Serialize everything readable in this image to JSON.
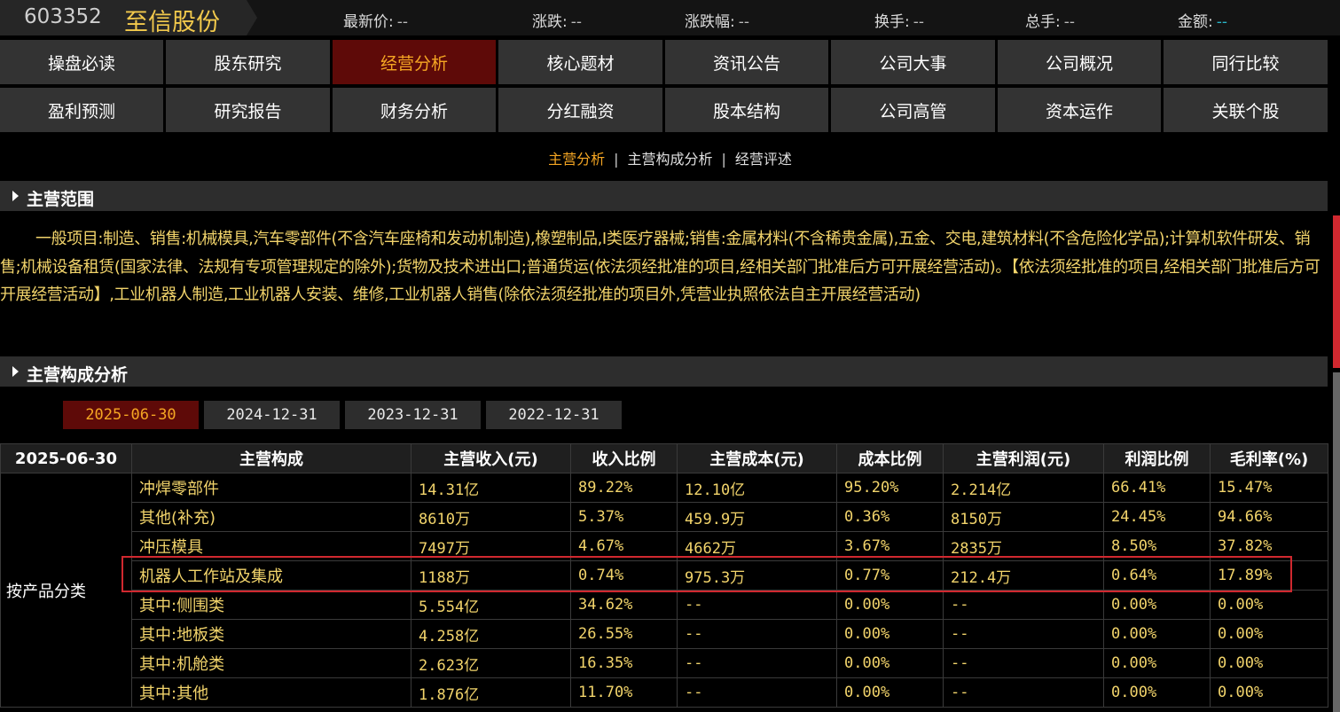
{
  "header": {
    "code": "603352",
    "name": "至信股份",
    "quotes": [
      {
        "label": "最新价:",
        "value": "--"
      },
      {
        "label": "涨跌:",
        "value": "--"
      },
      {
        "label": "涨跌幅:",
        "value": "--"
      },
      {
        "label": "换手:",
        "value": "--"
      },
      {
        "label": "总手:",
        "value": "--"
      },
      {
        "label": "金额:",
        "value": "--"
      }
    ]
  },
  "nav": {
    "row1": [
      "操盘必读",
      "股东研究",
      "经营分析",
      "核心题材",
      "资讯公告",
      "公司大事",
      "公司概况",
      "同行比较"
    ],
    "row2": [
      "盈利预测",
      "研究报告",
      "财务分析",
      "分红融资",
      "股本结构",
      "公司高管",
      "资本运作",
      "关联个股"
    ],
    "active": "经营分析"
  },
  "subnav": {
    "items": [
      "主营分析",
      "主营构成分析",
      "经营评述"
    ],
    "separator": "|",
    "active": "主营分析"
  },
  "scope_section": {
    "title": "主营范围",
    "text": "一般项目:制造、销售:机械模具,汽车零部件(不含汽车座椅和发动机制造),橡塑制品,Ⅰ类医疗器械;销售:金属材料(不含稀贵金属),五金、交电,建筑材料(不含危险化学品);计算机软件研发、销售;机械设备租赁(国家法律、法规有专项管理规定的除外);货物及技术进出口;普通货运(依法须经批准的项目,经相关部门批准后方可开展经营活动)。【依法须经批准的项目,经相关部门批准后方可开展经营活动】,工业机器人制造,工业机器人安装、维修,工业机器人销售(除依法须经批准的项目外,凭营业执照依法自主开展经营活动)"
  },
  "composition_section": {
    "title": "主营构成分析",
    "dates": [
      "2025-06-30",
      "2024-12-31",
      "2023-12-31",
      "2022-12-31"
    ],
    "active_date": "2025-06-30"
  },
  "table": {
    "headers": [
      "2025-06-30",
      "主营构成",
      "主营收入(元)",
      "收入比例",
      "主营成本(元)",
      "成本比例",
      "主营利润(元)",
      "利润比例",
      "毛利率(%)"
    ],
    "category": "按产品分类",
    "rows": [
      [
        "冲焊零部件",
        "14.31亿",
        "89.22%",
        "12.10亿",
        "95.20%",
        "2.214亿",
        "66.41%",
        "15.47%"
      ],
      [
        "其他(补充)",
        "8610万",
        "5.37%",
        "459.9万",
        "0.36%",
        "8150万",
        "24.45%",
        "94.66%"
      ],
      [
        "冲压模具",
        "7497万",
        "4.67%",
        "4662万",
        "3.67%",
        "2835万",
        "8.50%",
        "37.82%"
      ],
      [
        "机器人工作站及集成",
        "1188万",
        "0.74%",
        "975.3万",
        "0.77%",
        "212.4万",
        "0.64%",
        "17.89%"
      ],
      [
        "其中:侧围类",
        "5.554亿",
        "34.62%",
        "--",
        "0.00%",
        "--",
        "0.00%",
        "0.00%"
      ],
      [
        "其中:地板类",
        "4.258亿",
        "26.55%",
        "--",
        "0.00%",
        "--",
        "0.00%",
        "0.00%"
      ],
      [
        "其中:机舱类",
        "2.623亿",
        "16.35%",
        "--",
        "0.00%",
        "--",
        "0.00%",
        "0.00%"
      ],
      [
        "其中:其他",
        "1.876亿",
        "11.70%",
        "--",
        "0.00%",
        "--",
        "0.00%",
        "0.00%"
      ]
    ]
  },
  "colors": {
    "accent": "#f5a623",
    "active_bg": "#5e0a08",
    "text_yellow": "#f2d46b",
    "highlight_border": "#d0282f"
  }
}
